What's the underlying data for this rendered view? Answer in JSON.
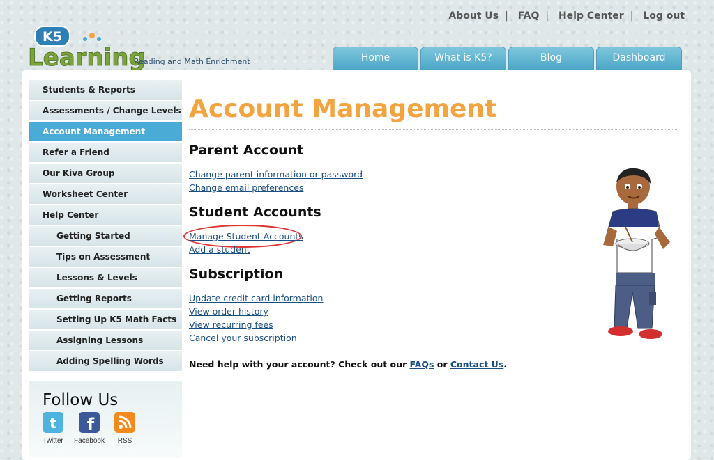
{
  "header": {
    "top_links": [
      "About Us",
      "FAQ",
      "Help Center",
      "Log out"
    ],
    "logo_badge": "K5",
    "logo_text": "Learning",
    "tagline": "Reading and Math Enrichment"
  },
  "nav": {
    "tabs": [
      "Home",
      "What is K5?",
      "Blog",
      "Dashboard"
    ]
  },
  "sidebar": {
    "items": [
      {
        "label": "Students & Reports"
      },
      {
        "label": "Assessments / Change Levels"
      },
      {
        "label": "Account Management"
      },
      {
        "label": "Refer a Friend"
      },
      {
        "label": "Our Kiva Group"
      },
      {
        "label": "Worksheet Center"
      },
      {
        "label": "Help Center"
      },
      {
        "label": "Getting Started"
      },
      {
        "label": "Tips on Assessment"
      },
      {
        "label": "Lessons & Levels"
      },
      {
        "label": "Getting Reports"
      },
      {
        "label": "Setting Up K5 Math Facts"
      },
      {
        "label": "Assigning Lessons"
      },
      {
        "label": "Adding Spelling Words"
      }
    ],
    "active_index": 2
  },
  "follow": {
    "title": "Follow Us",
    "items": [
      {
        "label": "Twitter",
        "icon": "twitter-icon",
        "color": "#4fb3e0"
      },
      {
        "label": "Facebook",
        "icon": "facebook-icon",
        "color": "#3b5998"
      },
      {
        "label": "RSS",
        "icon": "rss-icon",
        "color": "#f28a1e"
      }
    ]
  },
  "main": {
    "title": "Account Management",
    "sections": [
      {
        "heading": "Parent Account",
        "links": [
          "Change parent information or password",
          "Change email preferences"
        ]
      },
      {
        "heading": "Student Accounts",
        "links": [
          "Manage Student Accounts",
          "Add a student"
        ]
      },
      {
        "heading": "Subscription",
        "links": [
          "Update credit card information",
          "View order history",
          "View recurring fees",
          "Cancel your subscription"
        ]
      }
    ],
    "help": {
      "prefix": "Need help with your account? Check out our ",
      "faq_link": "FAQs",
      "middle": " or ",
      "contact_link": "Contact Us",
      "suffix": "."
    }
  },
  "colors": {
    "accent_title": "#f3a43f",
    "nav_tab": "#4aa6c6",
    "active_sidebar": "#4aabd6",
    "link": "#1a4f86",
    "highlight_circle": "#dd3333"
  }
}
